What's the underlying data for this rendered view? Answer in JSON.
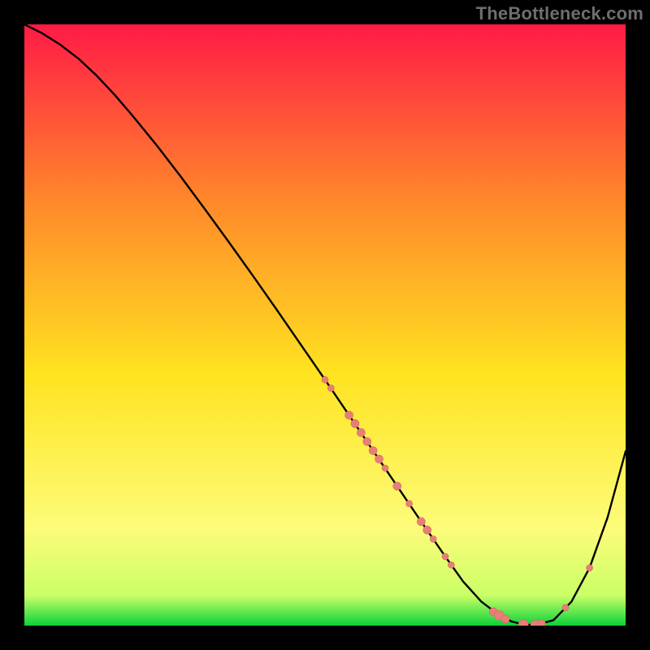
{
  "watermark": "TheBottleneck.com",
  "gradient": {
    "top": "#ff1a46",
    "mid_upper": "#ff8a2a",
    "mid": "#ffe320",
    "mid_lower": "#fdfc7a",
    "band": "#c9ff66",
    "bottom": "#0cd23a"
  },
  "colors": {
    "curve": "#000000",
    "marker_fill": "#e77f78",
    "marker_stroke": "#d26a63",
    "frame": "#000000"
  },
  "chart_data": {
    "type": "line",
    "title": "",
    "xlabel": "",
    "ylabel": "",
    "xlim": [
      0,
      100
    ],
    "ylim": [
      0,
      100
    ],
    "grid": false,
    "legend": false,
    "series": [
      {
        "name": "bottleneck-curve",
        "x": [
          0,
          3,
          6,
          9,
          12,
          15,
          18,
          22,
          26,
          30,
          34,
          38,
          42,
          46,
          50,
          54,
          58,
          62,
          66,
          70,
          73,
          76,
          79,
          81,
          83,
          85,
          88,
          91,
          94,
          97,
          100
        ],
        "y": [
          100,
          98.5,
          96.6,
          94.3,
          91.5,
          88.3,
          84.8,
          79.9,
          74.7,
          69.3,
          63.8,
          58.2,
          52.5,
          46.7,
          40.9,
          35.0,
          29.1,
          23.2,
          17.3,
          11.5,
          7.3,
          4.0,
          1.7,
          0.7,
          0.2,
          0.1,
          0.9,
          4.0,
          9.6,
          18.0,
          29.0
        ]
      }
    ],
    "markers": {
      "name": "highlighted-points",
      "x": [
        50,
        51,
        54,
        55,
        56,
        57,
        58,
        59,
        60,
        62,
        64,
        66,
        67,
        68,
        70,
        71,
        78,
        79,
        80,
        83,
        85,
        86,
        90,
        94
      ],
      "y": [
        40.9,
        39.5,
        35.0,
        33.6,
        32.1,
        30.6,
        29.1,
        27.7,
        26.2,
        23.2,
        20.3,
        17.3,
        15.9,
        14.4,
        11.5,
        10.1,
        2.3,
        1.7,
        1.1,
        0.2,
        0.1,
        0.3,
        3.0,
        9.6
      ],
      "r": [
        4,
        4,
        5,
        5,
        5,
        5,
        5,
        5,
        4,
        5,
        4,
        5,
        5,
        4,
        4,
        4,
        5,
        6,
        5,
        6,
        6,
        5,
        4,
        4
      ]
    }
  }
}
